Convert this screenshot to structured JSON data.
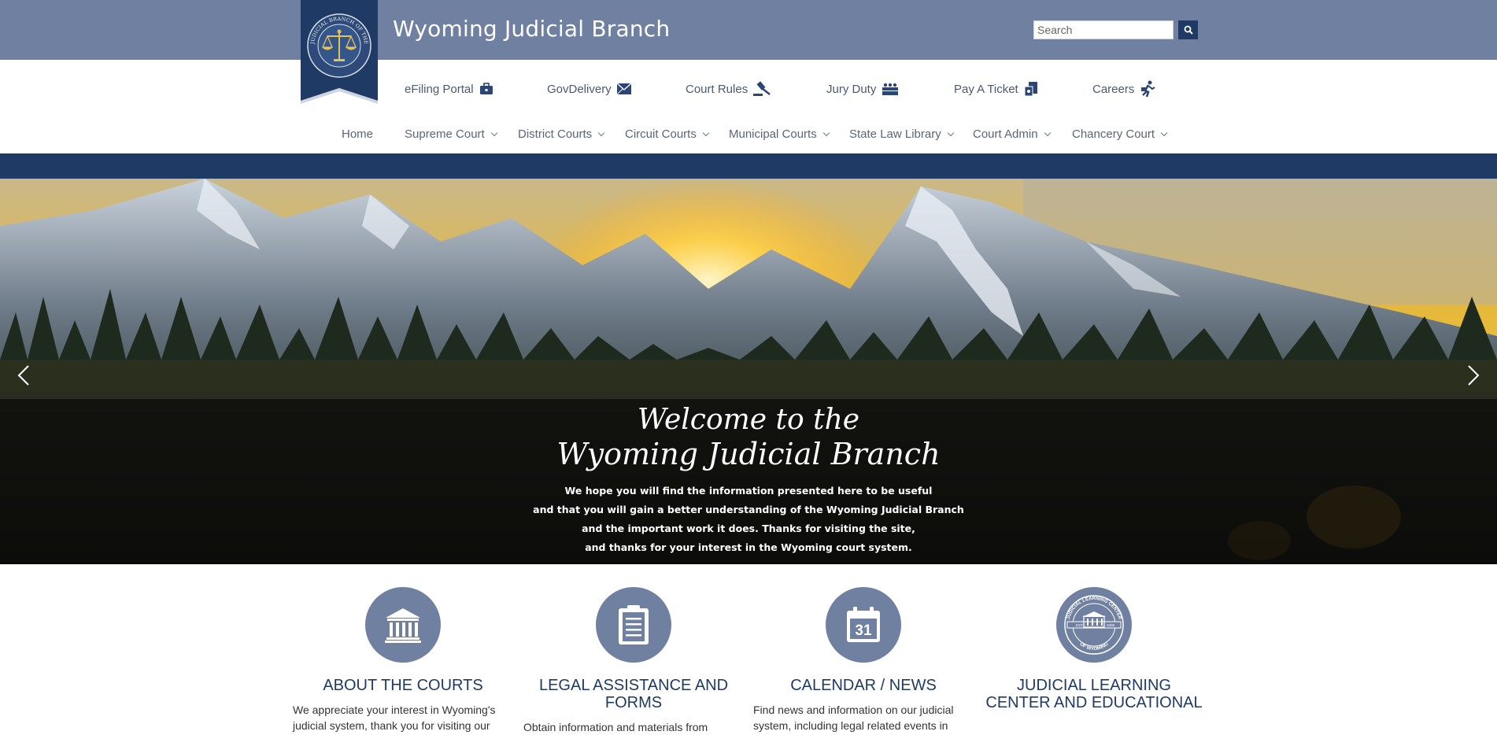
{
  "header": {
    "site_title": "Wyoming Judicial Branch",
    "search_placeholder": "Search",
    "seal_text": "JUDICIAL BRANCH OF THE STATE OF WYOMING"
  },
  "quick_links": [
    {
      "label": "eFiling Portal",
      "icon": "briefcase-icon"
    },
    {
      "label": "GovDelivery",
      "icon": "envelope-icon"
    },
    {
      "label": "Court Rules",
      "icon": "gavel-icon"
    },
    {
      "label": "Jury Duty",
      "icon": "jury-icon"
    },
    {
      "label": "Pay A Ticket",
      "icon": "ticket-icon"
    },
    {
      "label": "Careers",
      "icon": "runner-icon"
    }
  ],
  "nav": [
    {
      "label": "Home",
      "dropdown": false
    },
    {
      "label": "Supreme Court",
      "dropdown": true
    },
    {
      "label": "District Courts",
      "dropdown": true
    },
    {
      "label": "Circuit Courts",
      "dropdown": true
    },
    {
      "label": "Municipal Courts",
      "dropdown": true
    },
    {
      "label": "State Law Library",
      "dropdown": true
    },
    {
      "label": "Court Admin",
      "dropdown": true
    },
    {
      "label": "Chancery Court",
      "dropdown": true
    }
  ],
  "hero": {
    "welcome_line1": "Welcome to the",
    "welcome_line2": "Wyoming Judicial Branch",
    "intro_lines": [
      "We hope you will find the information presented here to be useful",
      "and that you will gain a better understanding of the Wyoming Judicial Branch",
      "and the important work it does. Thanks for visiting the site,",
      "and thanks for your interest in the Wyoming court system."
    ]
  },
  "features": [
    {
      "title": "ABOUT THE COURTS",
      "text": "We appreciate your interest in Wyoming's judicial system, thank you for visiting our",
      "icon": "courthouse-icon"
    },
    {
      "title": "LEGAL ASSISTANCE AND FORMS",
      "text": "Obtain information and materials from",
      "icon": "clipboard-icon"
    },
    {
      "title": "CALENDAR / NEWS",
      "text": "Find news and information on our judicial system, including legal related events in",
      "icon": "calendar-icon",
      "calendar_day": "31"
    },
    {
      "title": "JUDICIAL LEARNING CENTER AND EDUCATIONAL",
      "text": "",
      "icon": "learning-center-seal-icon",
      "seal_top": "JUDICIAL LEARNING CENTER",
      "seal_bottom": "OF WYOMING",
      "seal_est": "EST.",
      "seal_year": "2008"
    }
  ],
  "colors": {
    "header_bg": "#7080a0",
    "navy": "#1f3a64",
    "icon_circle": "#7080a0"
  }
}
